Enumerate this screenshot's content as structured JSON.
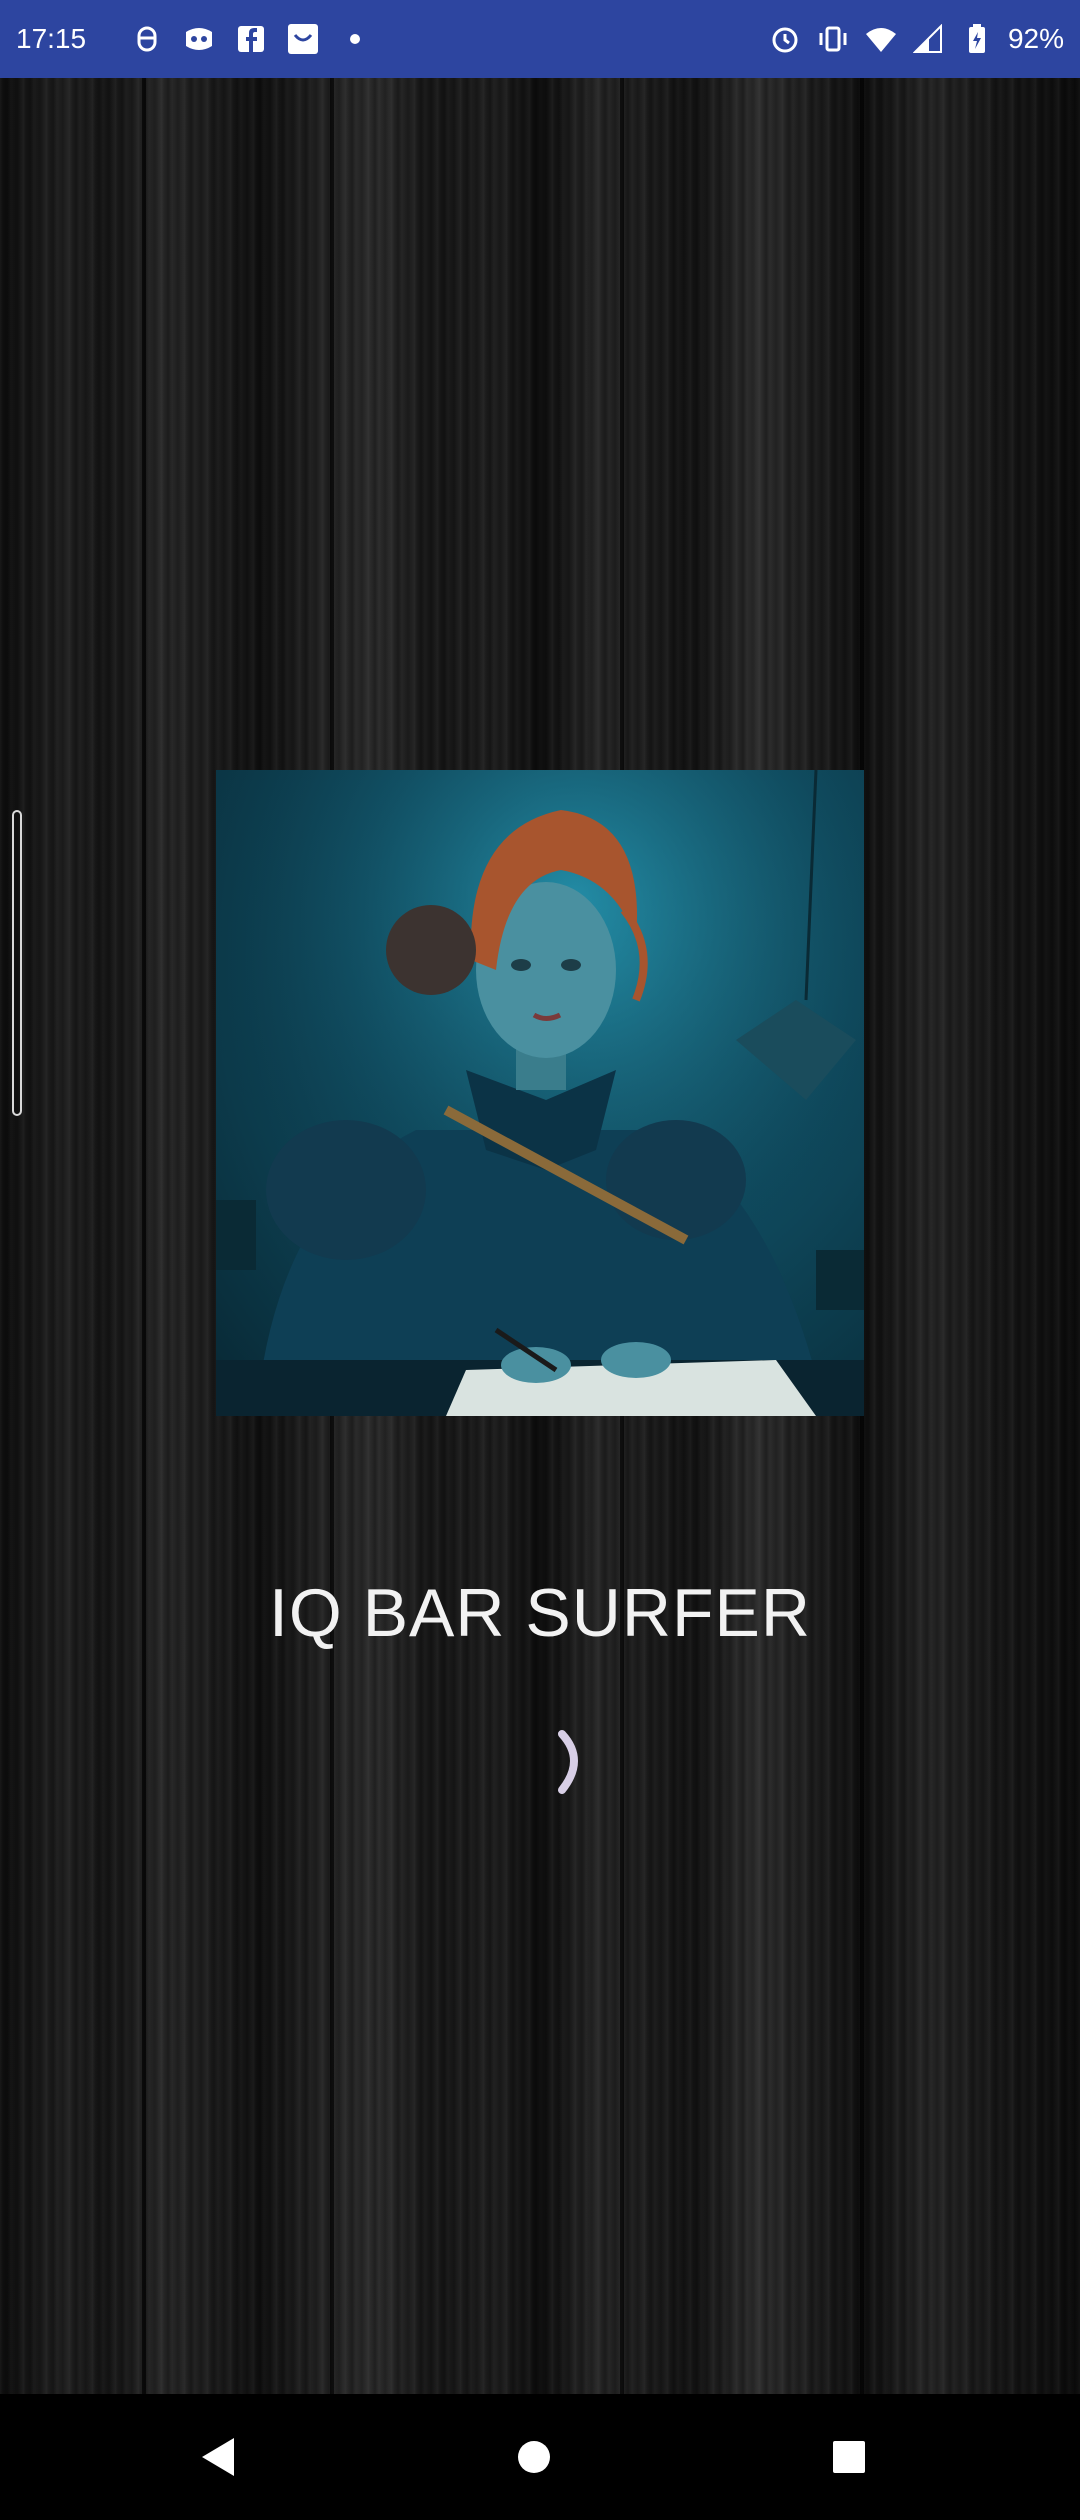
{
  "status_bar": {
    "time": "17:15",
    "notification_icons": [
      "usb-icon",
      "discord-icon",
      "facebook-icon",
      "inbox-icon",
      "dot-icon"
    ],
    "system_icons": [
      "alarm-icon",
      "vibrate-icon",
      "wifi-icon",
      "signal-icon",
      "battery-icon"
    ],
    "battery_percent": "92%",
    "background_color": "#2d45a0"
  },
  "main": {
    "app_title": "IQ BAR SURFER",
    "loading": true
  },
  "nav_bar": {
    "buttons": [
      "back-icon",
      "home-icon",
      "recents-icon"
    ]
  }
}
